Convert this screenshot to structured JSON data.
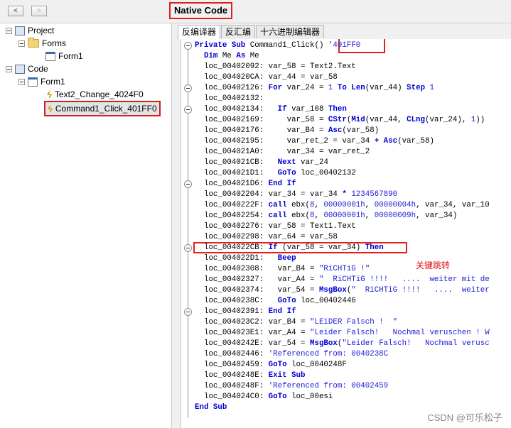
{
  "toolbar": {
    "back": "<",
    "forward": ">",
    "title": "Native Code"
  },
  "tree": {
    "project": "Project",
    "forms": "Forms",
    "form1_forms": "Form1",
    "code": "Code",
    "form1_code": "Form1",
    "text2_change": "Text2_Change_4024F0",
    "command1_click": "Command1_Click_401FF0"
  },
  "tabs": [
    "反编译器",
    "反汇编",
    "十六进制编辑器"
  ],
  "annotation": "关键跳转",
  "watermark": "CSDN @可乐松子",
  "code_lines": [
    "<span class='kw'>Private Sub</span> Command1_Click() <span class='cm'>'401FF0</span>",
    "  <span class='kw'>Dim</span> Me <span class='kw'>As</span> Me",
    "  loc_00402092: var_58 = Text2.Text",
    "  loc_004020CA: var_44 = var_58",
    "  loc_00402126: <span class='kw'>For</span> var_24 = <span class='num'>1</span> <span class='kw'>To</span> <span class='kw'>Len</span>(var_44) <span class='kw'>Step</span> <span class='num'>1</span>",
    "  loc_00402132:",
    "  loc_00402134:   <span class='kw'>If</span> var_108 <span class='kw'>Then</span>",
    "  loc_00402169:     var_58 = <span class='kw'>CStr</span>(<span class='kw'>Mid</span>(var_44, <span class='kw'>CLng</span>(var_24), <span class='num'>1</span>))",
    "  loc_00402176:     var_B4 = <span class='kw'>Asc</span>(var_58)",
    "  loc_00402195:     var_ret_2 = var_34 <span class='kw'>+</span> <span class='kw'>Asc</span>(var_58)",
    "  loc_004021A0:     var_34 = var_ret_2",
    "  loc_004021CB:   <span class='kw'>Next</span> var_24",
    "  loc_004021D1:   <span class='kw'>GoTo</span> loc_00402132",
    "  loc_004021D6: <span class='kw'>End If</span>",
    "  loc_00402204: var_34 = var_34 <span class='kw'>*</span> <span class='num'>1234567890</span>",
    "  loc_0040222F: <span class='kw'>call</span> ebx(<span class='num'>8</span>, <span class='num'>00000001h</span>, <span class='num'>00000004h</span>, var_34, var_10",
    "  loc_00402254: <span class='kw'>call</span> ebx(<span class='num'>8</span>, <span class='num'>00000001h</span>, <span class='num'>00000009h</span>, var_34)",
    "  loc_00402276: var_58 = Text1.Text",
    "  loc_00402298: var_64 = var_58",
    "  loc_004022CB: <span class='kw'>If</span> (var_58 = var_34) <span class='kw'>Then</span>",
    "  loc_004022D1:   <span class='kw'>Beep</span>",
    "  loc_00402308:   var_B4 = <span class='cm'>\"RiCHTiG !\"</span>",
    "  loc_00402327:   var_A4 = <span class='cm'>\"  RiCHTiG !!!!   ....  weiter mit de</span>",
    "  loc_00402374:   var_54 = <span class='kw'>MsgBox</span>(<span class='cm'>\"  RiCHTiG !!!!   ....  weiter</span>",
    "  loc_0040238C:   <span class='kw'>GoTo</span> loc_00402446",
    "  loc_00402391: <span class='kw'>End If</span>",
    "  loc_004023C2: var_B4 = <span class='cm'>\"LEiDER Falsch !  \"</span>",
    "  loc_004023E1: var_A4 = <span class='cm'>\"Leider Falsch!   Nochmal veruschen ! W</span>",
    "  loc_0040242E: var_54 = <span class='kw'>MsgBox</span>(<span class='cm'>\"Leider Falsch!   Nochmal verusc</span>",
    "  loc_00402446: <span class='cm'>'Referenced from: 0040238C</span>",
    "  loc_00402459: <span class='kw'>GoTo</span> loc_0040248F",
    "  loc_0040248E: <span class='kw'>Exit Sub</span>",
    "  loc_0040248F: <span class='cm'>'Referenced from: 00402459</span>",
    "  loc_004024C0: <span class='kw'>GoTo</span> loc_00esi",
    "<span class='kw'>End Sub</span>"
  ]
}
